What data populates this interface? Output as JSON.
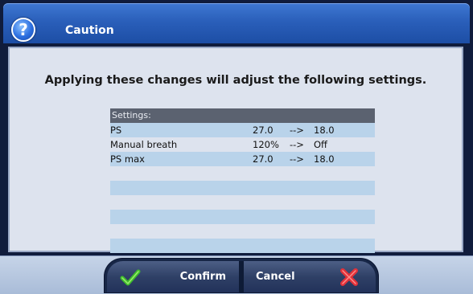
{
  "dialog": {
    "title": "Caution",
    "icon": "help-icon",
    "message": "Applying these changes will adjust the following settings."
  },
  "settings": {
    "header": "Settings:",
    "rows": [
      {
        "name": "PS",
        "old": "27.0",
        "arrow": "-->",
        "new": "18.0"
      },
      {
        "name": "Manual breath",
        "old": "120%",
        "arrow": "-->",
        "new": "Off"
      },
      {
        "name": "PS max",
        "old": "27.0",
        "arrow": "-->",
        "new": "18.0"
      }
    ]
  },
  "buttons": {
    "confirm_label": "Confirm",
    "cancel_label": "Cancel",
    "confirm_icon": "check-icon",
    "cancel_icon": "x-icon"
  },
  "colors": {
    "titlebar": "#2a5fba",
    "content_bg": "#dde3ee",
    "header_bg": "#5b6270",
    "row_alt": "#b9d3ea",
    "confirm_icon": "#3fbf2a",
    "cancel_icon": "#e2323a"
  }
}
